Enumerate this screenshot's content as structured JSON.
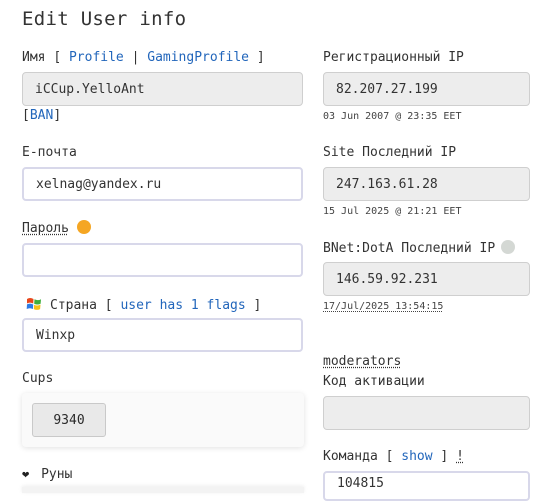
{
  "page": {
    "title": "Edit User info"
  },
  "left": {
    "name_label": "Имя",
    "name_links": {
      "profile": "Profile",
      "gaming_profile": "GamingProfile"
    },
    "name_value": "iCCup.YelloAnt",
    "ban_link": "BAN",
    "email_label": "E-почта",
    "email_value": "xelnag@yandex.ru",
    "password_label": "Пароль",
    "password_value": "",
    "country_label": "Страна",
    "country_flags_link": "user has 1 flags",
    "country_value": "Winxp",
    "cups_label": "Cups",
    "cups_value": "9340",
    "runes_label": "Руны"
  },
  "right": {
    "reg_ip_label": "Регистрационный IP",
    "reg_ip_value": "82.207.27.199",
    "reg_ip_date": "03 Jun 2007 @ 23:35 EET",
    "site_ip_label": "Site Последний IP",
    "site_ip_value": "247.163.61.28",
    "site_ip_date": "15 Jul 2025 @ 21:21 EET",
    "bnet_ip_label": "BNet:DotA Последний IP",
    "bnet_ip_value": "146.59.92.231",
    "bnet_ip_date": "17/Jul/2025 13:54:15",
    "moderators_label": "moderators",
    "activation_label": "Код активации",
    "activation_value": "",
    "team_label": "Команда",
    "team_show_link": "show",
    "team_excl": "!",
    "team_value": "104815"
  },
  "colors": {
    "link": "#2266bb",
    "status_orange": "#f5a623",
    "status_grey": "#d4d8d4"
  },
  "icons": {
    "heart": "heart-icon",
    "windows_flag": "windows-flag-icon"
  }
}
